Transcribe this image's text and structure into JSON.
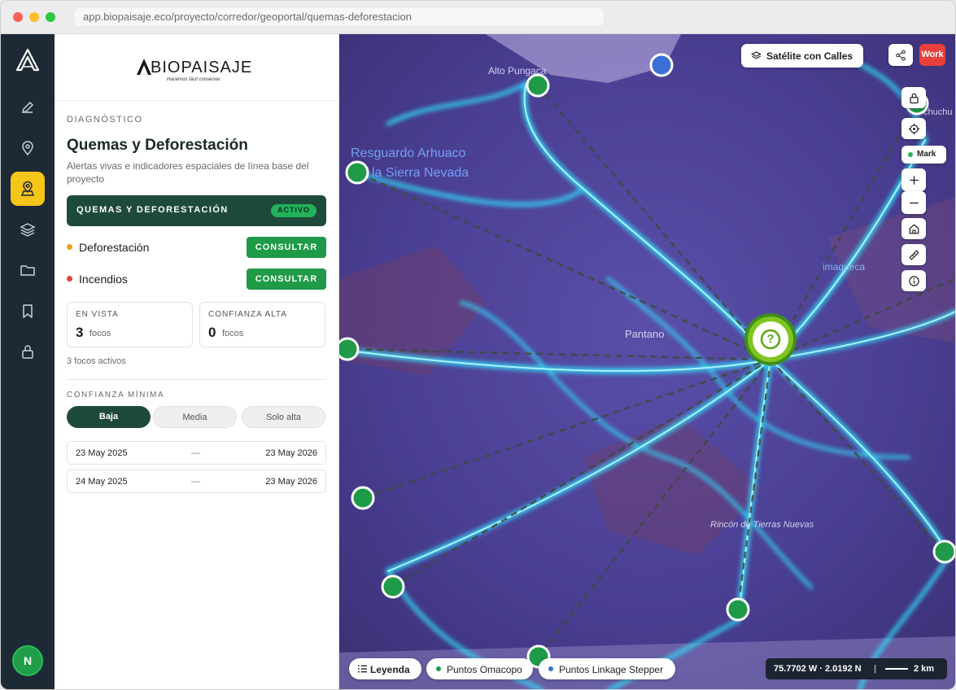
{
  "browser": {
    "url": "app.biopaisaje.eco/proyecto/corredor/geoportal/quemas-deforestacion"
  },
  "rail": {
    "items": [
      {
        "name": "edit-icon"
      },
      {
        "name": "map-pin-icon"
      },
      {
        "name": "location-user-icon",
        "active": true
      },
      {
        "name": "layers-icon"
      },
      {
        "name": "folder-icon"
      },
      {
        "name": "bookmark-icon"
      },
      {
        "name": "lock-icon"
      }
    ],
    "avatar": "N"
  },
  "brand": {
    "name": "BIOPAISAJE",
    "tagline": "Hacemos fácil conservar"
  },
  "panel": {
    "section": "DIAGNÓSTICO",
    "title": "Quemas y Deforestación",
    "subtitle": "Alertas vivas e indicadores espaciales de línea base del proyecto",
    "banner": {
      "label": "QUEMAS Y DEFORESTACIÓN",
      "status": "ACTIVO"
    },
    "layers": [
      {
        "label": "Deforestación",
        "color": "#e8a317",
        "action": "CONSULTAR"
      },
      {
        "label": "Incendios",
        "color": "#e0413a",
        "action": "CONSULTAR"
      }
    ],
    "stats": [
      {
        "label": "EN VISTA",
        "value": "3",
        "unit": "focos"
      },
      {
        "label": "CONFIANZA ALTA",
        "value": "0",
        "unit": "focos"
      }
    ],
    "active_note": "3 focos activos",
    "confidence": {
      "label": "CONFIANZA MÍNIMA",
      "options": [
        "Baja",
        "Media",
        "Solo alta"
      ],
      "selected": "Baja"
    },
    "date_ranges": [
      {
        "from": "23 May 2025",
        "sep": "—",
        "to": "23 May 2026"
      },
      {
        "from": "24 May 2025",
        "sep": "—",
        "to": "23 May 2026"
      }
    ]
  },
  "map": {
    "basemap_label": "Satélite con Calles",
    "work_label": "Work",
    "mark_label": "Mark",
    "labels": [
      "Alto Pungaca",
      "Resguardo Arhuaco",
      "la Sierra Nevada",
      "Pantano",
      "Rincón de Tierras Nuevas",
      "imaqueca",
      "chuchu"
    ],
    "legend_label": "Leyenda",
    "chips": [
      {
        "label": "Puntos Omacopo",
        "color": "#1e9a48"
      },
      {
        "label": "Puntos Linkage Stepper",
        "color": "#3b6fd6"
      }
    ],
    "coordinates": "75.7702 W · 2.0192 N",
    "scale": "2 km",
    "center_icon": "?"
  },
  "colors": {
    "rail_bg": "#1d2a36",
    "accent_green": "#1e9a48",
    "dark_green": "#1e4a3b",
    "active_yellow": "#f5c518"
  }
}
